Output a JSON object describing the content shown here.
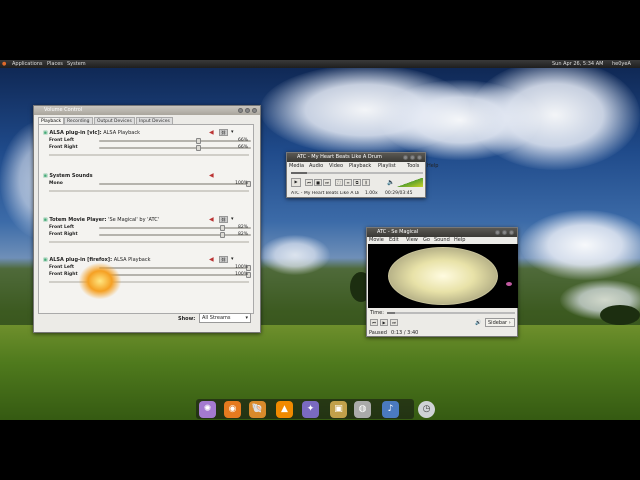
{
  "top_panel": {
    "menus": [
      "Applications",
      "Places",
      "System"
    ],
    "clock": "Sun Apr 26,  5:34 AM",
    "user": "he0yeA"
  },
  "volume_control": {
    "title": "Volume Control",
    "tabs": [
      "Playback",
      "Recording",
      "Output Devices",
      "Input Devices"
    ],
    "streams": [
      {
        "app": "ALSA plug-in [vlc]:",
        "name": "ALSA Playback",
        "channels": [
          {
            "label": "Front Left",
            "pct": "66%",
            "level": 0.66
          },
          {
            "label": "Front Right",
            "pct": "66%",
            "level": 0.66
          }
        ]
      },
      {
        "app": "System Sounds",
        "name": "",
        "channels": [
          {
            "label": "Mono",
            "pct": "100%",
            "level": 1.0
          }
        ]
      },
      {
        "app": "Totem Movie Player:",
        "name": "'Se Magical' by 'ATC'",
        "channels": [
          {
            "label": "Front Left",
            "pct": "82%",
            "level": 0.82
          },
          {
            "label": "Front Right",
            "pct": "82%",
            "level": 0.82
          }
        ]
      },
      {
        "app": "ALSA plug-in [firefox]:",
        "name": "ALSA Playback",
        "channels": [
          {
            "label": "Front Left",
            "pct": "100%",
            "level": 1.0
          },
          {
            "label": "Front Right",
            "pct": "100%",
            "level": 1.0
          }
        ]
      }
    ],
    "show_label": "Show:",
    "show_value": "All Streams"
  },
  "vlc": {
    "title": "ATC - My Heart Beats Like A Drum",
    "menu": [
      "Media",
      "Audio",
      "Video",
      "Playback",
      "Playlist",
      "Tools",
      "Help"
    ],
    "status_title": "ATC - My Heart Beats Like A Drum",
    "speed": "1.00x",
    "time": "00:29/03:45"
  },
  "totem": {
    "title": "ATC - Se Magical",
    "menu": [
      "Movie",
      "Edit",
      "View",
      "Go",
      "Sound",
      "Help"
    ],
    "time_label": "Time:",
    "sidebar_label": "Sidebar",
    "status": "Paused",
    "position": "0:13 / 3:40"
  },
  "dock": {
    "icons": [
      "settings-icon",
      "firefox-icon",
      "nautilus-icon",
      "vlc-icon",
      "pidgin-icon",
      "photo-icon",
      "disk-icon",
      "media-icon",
      "clock-icon"
    ]
  }
}
